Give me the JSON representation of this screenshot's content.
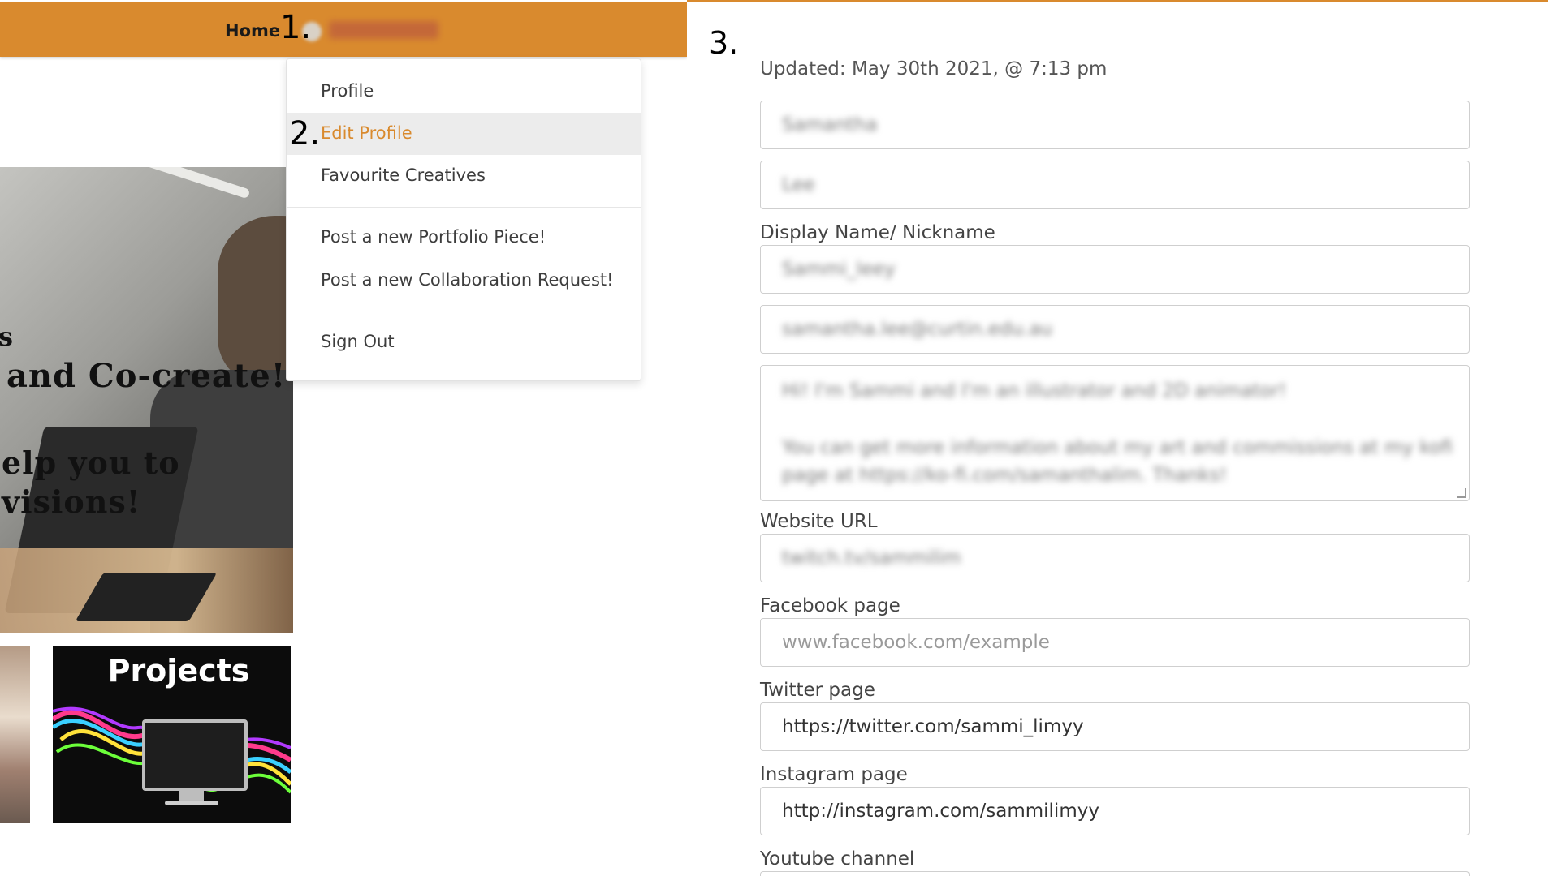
{
  "nav": {
    "home_label": "Home",
    "username": "Sammi_leey",
    "step_1": "1.",
    "step_2": "2.",
    "step_3": "3."
  },
  "dropdown": {
    "items": [
      {
        "label": "Profile"
      },
      {
        "label": "Edit Profile",
        "active": true
      },
      {
        "label": "Favourite Creatives"
      },
      {
        "label": "Post a new Portfolio Piece!"
      },
      {
        "label": "Post a new Collaboration Request!"
      },
      {
        "label": "Sign Out"
      }
    ]
  },
  "hero": {
    "line1": "s",
    "line2": "and Co-create!",
    "line3": "elp you to",
    "line4": "visions!"
  },
  "thumbnails": {
    "projects_title": "Projects"
  },
  "form": {
    "updated": "Updated: May 30th 2021, @ 7:13 pm",
    "first_name": "Samantha",
    "last_name": "Lee",
    "display_name_label": "Display Name/ Nickname",
    "display_name": "Sammi_leey",
    "email": "samantha.lee@curtin.edu.au",
    "bio_line1": "Hi! I'm Sammi and I'm an illustrator and 2D animator!",
    "bio_line2": "You can get more information about my art and commissions at my kofi",
    "bio_line3": "page at https://ko-fi.com/samanthalim. Thanks!",
    "website_label": "Website URL",
    "website": "twitch.tv/sammilim",
    "facebook_label": "Facebook page",
    "facebook_placeholder": "www.facebook.com/example",
    "twitter_label": "Twitter page",
    "twitter": "https://twitter.com/sammi_limyy",
    "instagram_label": "Instagram page",
    "instagram": "http://instagram.com/sammilimyy",
    "youtube_label": "Youtube channel"
  },
  "colors": {
    "accent": "#d98a2e",
    "active_item_bg": "#ececec"
  }
}
